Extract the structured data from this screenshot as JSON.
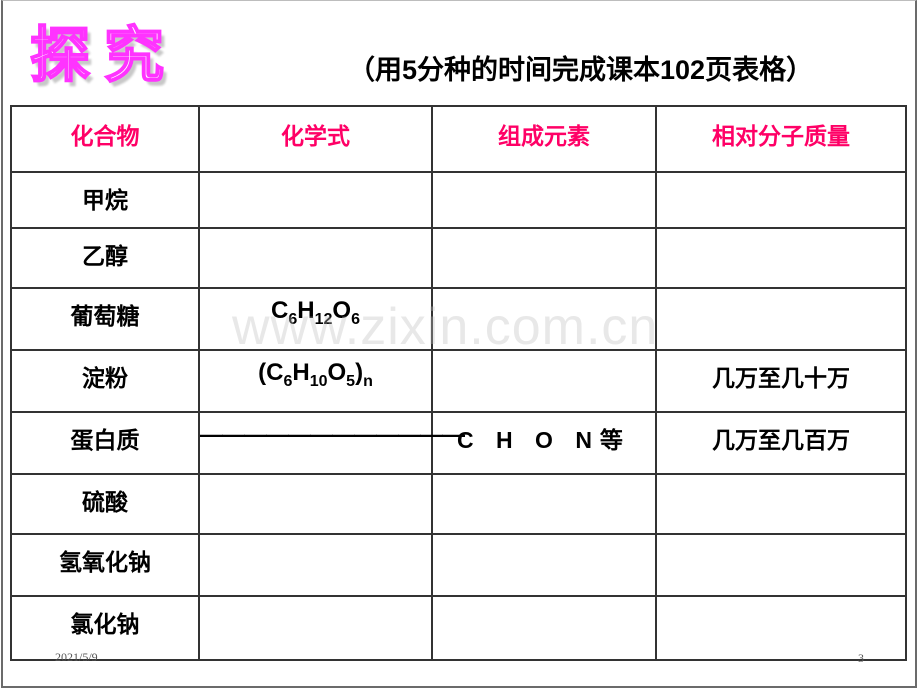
{
  "slide": {
    "title_art": "探究",
    "subtitle": "（用5分种的时间完成课本102页表格）",
    "watermark": "www.zixin.com.cn",
    "footer_date": "2021/5/9",
    "page_number": "3",
    "colors": {
      "header_text": "#ff0066",
      "title_art_outline": "#ff33ff",
      "border": "#333333"
    }
  },
  "table": {
    "headers": [
      "化合物",
      "化学式",
      "组成元素",
      "相对分子质量"
    ],
    "rows": [
      {
        "compound": "甲烷",
        "formula": "",
        "elements": "",
        "mass": ""
      },
      {
        "compound": "乙醇",
        "formula": "",
        "elements": "",
        "mass": ""
      },
      {
        "compound": "葡萄糖",
        "formula": "C6H12O6",
        "elements": "",
        "mass": ""
      },
      {
        "compound": "淀粉",
        "formula": "(C6H10O5)n",
        "elements": "",
        "mass": "几万至几十万"
      },
      {
        "compound": "蛋白质",
        "formula": "————————————",
        "elements": "C H O N等",
        "mass": "几万至几百万"
      },
      {
        "compound": "硫酸",
        "formula": "",
        "elements": "",
        "mass": ""
      },
      {
        "compound": "氢氧化钠",
        "formula": "",
        "elements": "",
        "mass": ""
      },
      {
        "compound": "氯化钠",
        "formula": "",
        "elements": "",
        "mass": ""
      }
    ],
    "formula_parts": {
      "glucose": [
        [
          "C",
          ""
        ],
        [
          "6",
          "sub"
        ],
        [
          "H",
          ""
        ],
        [
          "12",
          "sub"
        ],
        [
          "O",
          ""
        ],
        [
          "6",
          "sub"
        ]
      ],
      "starch": [
        [
          "(C",
          ""
        ],
        [
          "6",
          "sub"
        ],
        [
          "H",
          ""
        ],
        [
          "10",
          "sub"
        ],
        [
          "O",
          ""
        ],
        [
          "5",
          "sub"
        ],
        [
          ")",
          ""
        ],
        [
          "n",
          "sub"
        ]
      ]
    }
  }
}
